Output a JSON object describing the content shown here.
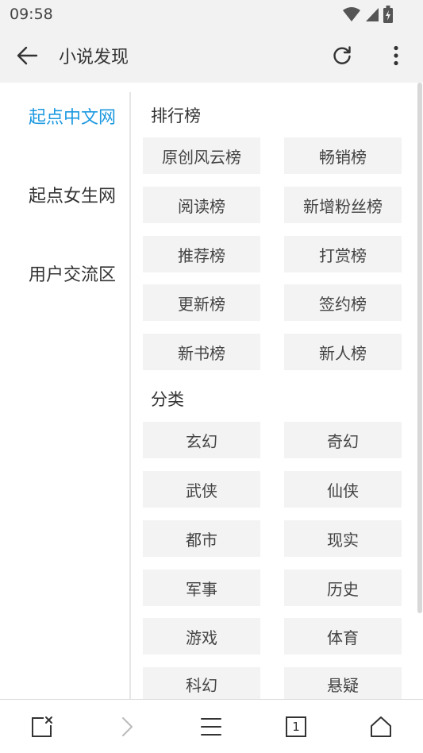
{
  "status_bar": {
    "time": "09:58"
  },
  "app_bar": {
    "title": "小说发现"
  },
  "left_nav": {
    "items": [
      {
        "label": "起点中文网",
        "active": true
      },
      {
        "label": "起点女生网",
        "active": false
      },
      {
        "label": "用户交流区",
        "active": false
      }
    ]
  },
  "sections": {
    "ranking": {
      "title": "排行榜",
      "items": [
        "原创风云榜",
        "畅销榜",
        "阅读榜",
        "新增粉丝榜",
        "推荐榜",
        "打赏榜",
        "更新榜",
        "签约榜",
        "新书榜",
        "新人榜"
      ]
    },
    "category": {
      "title": "分类",
      "items": [
        "玄幻",
        "奇幻",
        "武侠",
        "仙侠",
        "都市",
        "现实",
        "军事",
        "历史",
        "游戏",
        "体育",
        "科幻",
        "悬疑"
      ]
    }
  },
  "bottom_bar": {
    "tab_count": "1"
  },
  "colors": {
    "accent": "#1e9ae0",
    "button_bg": "#f3f3f3",
    "bar_bg": "#f2f2f2"
  }
}
